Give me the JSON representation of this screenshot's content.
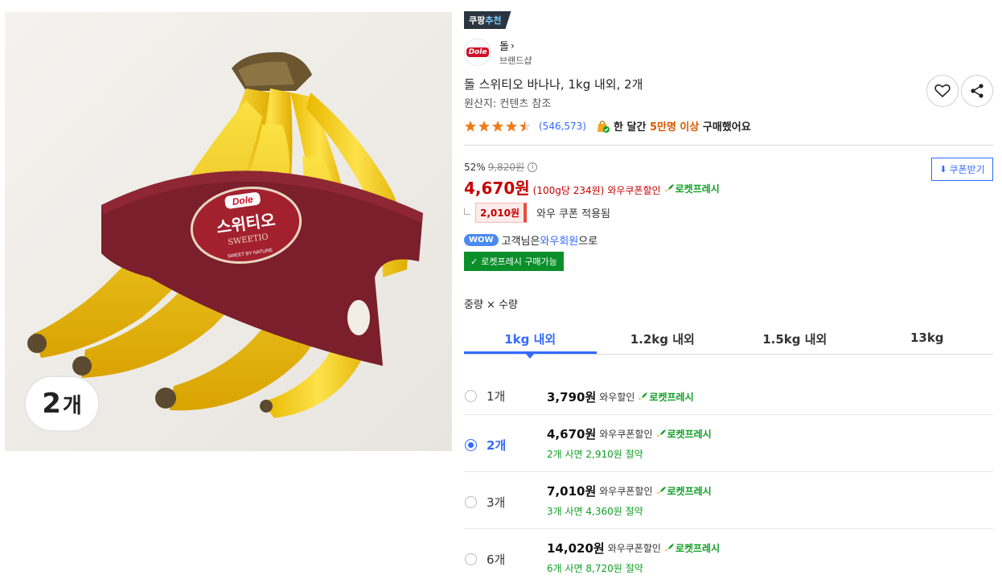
{
  "image": {
    "qty_badge_number": "2",
    "qty_badge_unit": "개",
    "package_brand": "Dole",
    "package_product": "스위티오",
    "package_product_en": "SWEETIO",
    "package_sub": "SWEET BY NATURE"
  },
  "badge": {
    "prefix": "쿠팡",
    "accent": "추천"
  },
  "brand": {
    "name": "돌",
    "chevron": "›",
    "sub": "브랜드샵",
    "logo_text": "Dole"
  },
  "product": {
    "title": "돌 스위티오 바나나, 1kg 내외, 2개",
    "origin": "원산지: 컨텐츠 참조"
  },
  "rating": {
    "stars": 4.5,
    "review_count": "(546,573)",
    "buy_prefix": "한 달간 ",
    "buy_highlight": "5만명 이상",
    "buy_suffix": " 구매했어요"
  },
  "price": {
    "discount_rate": "52%",
    "original": "9,820원",
    "info": "i",
    "current": "4,670원",
    "unit_price": "(100g당 234원)",
    "wow_discount": "와우쿠폰할인",
    "rocket_label": "로켓프레시",
    "coupon_button": "쿠폰받기",
    "coupon_amount": "2,010원",
    "coupon_label": "와우 쿠폰 적용됨"
  },
  "wow": {
    "pill": "WOW",
    "text_prefix": "고객님은 ",
    "text_link": "와우회원",
    "text_suffix": "으로"
  },
  "rocket_available": "로켓프레시 구매가능",
  "options": {
    "label": "중량 × 수량",
    "tabs": [
      "1kg 내외",
      "1.2kg 내외",
      "1.5kg 내외",
      "13kg"
    ],
    "active_tab": 0,
    "items": [
      {
        "qty": "1개",
        "price": "3,790원",
        "discount": "와우할인",
        "rocket": "로켓프레시",
        "saving": "",
        "selected": false
      },
      {
        "qty": "2개",
        "price": "4,670원",
        "discount": "와우쿠폰할인",
        "rocket": "로켓프레시",
        "saving": "2개 사면 2,910원 절약",
        "selected": true
      },
      {
        "qty": "3개",
        "price": "7,010원",
        "discount": "와우쿠폰할인",
        "rocket": "로켓프레시",
        "saving": "3개 사면 4,360원 절약",
        "selected": false
      },
      {
        "qty": "6개",
        "price": "14,020원",
        "discount": "와우쿠폰할인",
        "rocket": "로켓프레시",
        "saving": "6개 사면 8,720원 절약",
        "selected": false
      }
    ]
  },
  "colors": {
    "accent_blue": "#346aff",
    "price_red": "#c60000",
    "rocket_green": "#129f26",
    "star": "#f07b1a"
  }
}
